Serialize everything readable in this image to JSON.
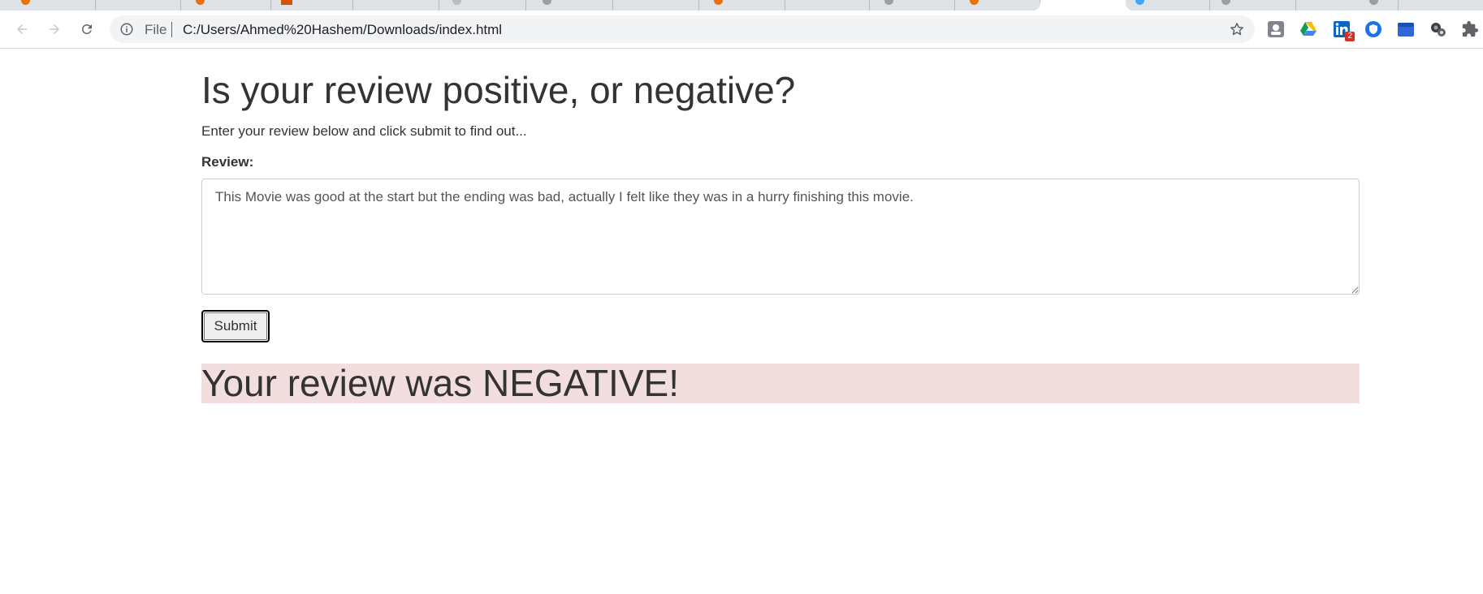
{
  "browser": {
    "omnibox": {
      "scheme_label": "File",
      "url": "C:/Users/Ahmed%20Hashem/Downloads/index.html"
    },
    "extensions": [
      {
        "name": "extension-1-icon"
      },
      {
        "name": "google-drive-icon"
      },
      {
        "name": "linkedin-icon",
        "badge": "2"
      },
      {
        "name": "extension-blue-shield-icon"
      },
      {
        "name": "extension-blue-calendar-icon"
      },
      {
        "name": "extension-gears-icon"
      },
      {
        "name": "extensions-puzzle-icon"
      }
    ],
    "colors": {
      "tabstrip": "#dee1e6",
      "omnibox": "#f1f3f4",
      "linkedin": "#0a66c2",
      "badge": "#d93025"
    }
  },
  "page": {
    "heading": "Is your review positive, or negative?",
    "intro": "Enter your review below and click submit to find out...",
    "review_label": "Review:",
    "review_text": "This Movie was good at the start but the ending was bad, actually I felt like they was in a hurry finishing this movie.",
    "submit_label": "Submit",
    "result": "Your review was NEGATIVE!",
    "result_color": "#f2dede"
  }
}
